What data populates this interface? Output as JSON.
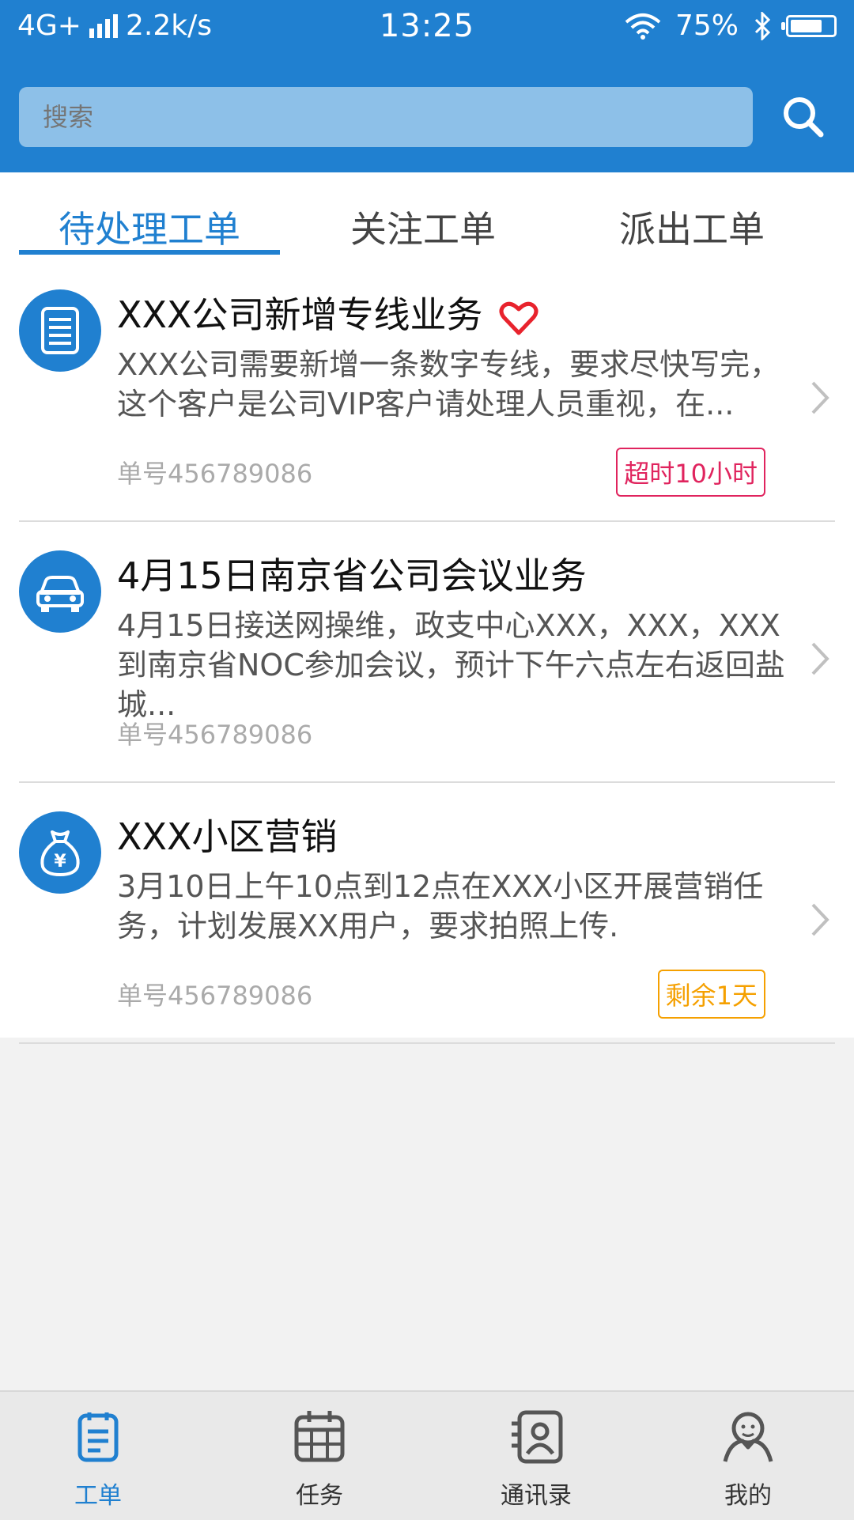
{
  "status_bar": {
    "network": "4G+",
    "speed": "2.2k/s",
    "time": "13:25",
    "battery": "75%",
    "battery_level": 0.75
  },
  "search": {
    "placeholder": "搜索"
  },
  "tabs": [
    {
      "label": "待处理工单",
      "active": true
    },
    {
      "label": "关注工单",
      "active": false
    },
    {
      "label": "派出工单",
      "active": false
    }
  ],
  "work_orders": [
    {
      "icon": "document-icon",
      "title": "XXX公司新增专线业务",
      "favorited": true,
      "description": "XXX公司需要新增一条数字专线，要求尽快写完，这个客户是公司VIP客户请处理人员重视，在...",
      "order_no": "单号456789086",
      "badge": "超时10小时",
      "badge_color": "#e0245e"
    },
    {
      "icon": "car-icon",
      "title": "4月15日南京省公司会议业务",
      "favorited": false,
      "description": "4月15日接送网操维，政支中心XXX，XXX，XXX到南京省NOC参加会议，预计下午六点左右返回盐城...",
      "order_no": "单号456789086",
      "badge": "",
      "badge_color": ""
    },
    {
      "icon": "money-bag-icon",
      "title": "XXX小区营销",
      "favorited": false,
      "description": "3月10日上午10点到12点在XXX小区开展营销任务，计划发展XX用户，要求拍照上传.",
      "order_no": "单号456789086",
      "badge": "剩余1天",
      "badge_color": "#f5a000"
    }
  ],
  "bottom_nav": [
    {
      "label": "工单",
      "icon": "work-order-icon",
      "active": true
    },
    {
      "label": "任务",
      "icon": "calendar-icon",
      "active": false
    },
    {
      "label": "通讯录",
      "icon": "contacts-icon",
      "active": false
    },
    {
      "label": "我的",
      "icon": "profile-icon",
      "active": false
    }
  ],
  "colors": {
    "primary": "#2080d0",
    "overdue": "#e0245e",
    "remaining": "#f5a000",
    "favorite": "#e8232d"
  }
}
